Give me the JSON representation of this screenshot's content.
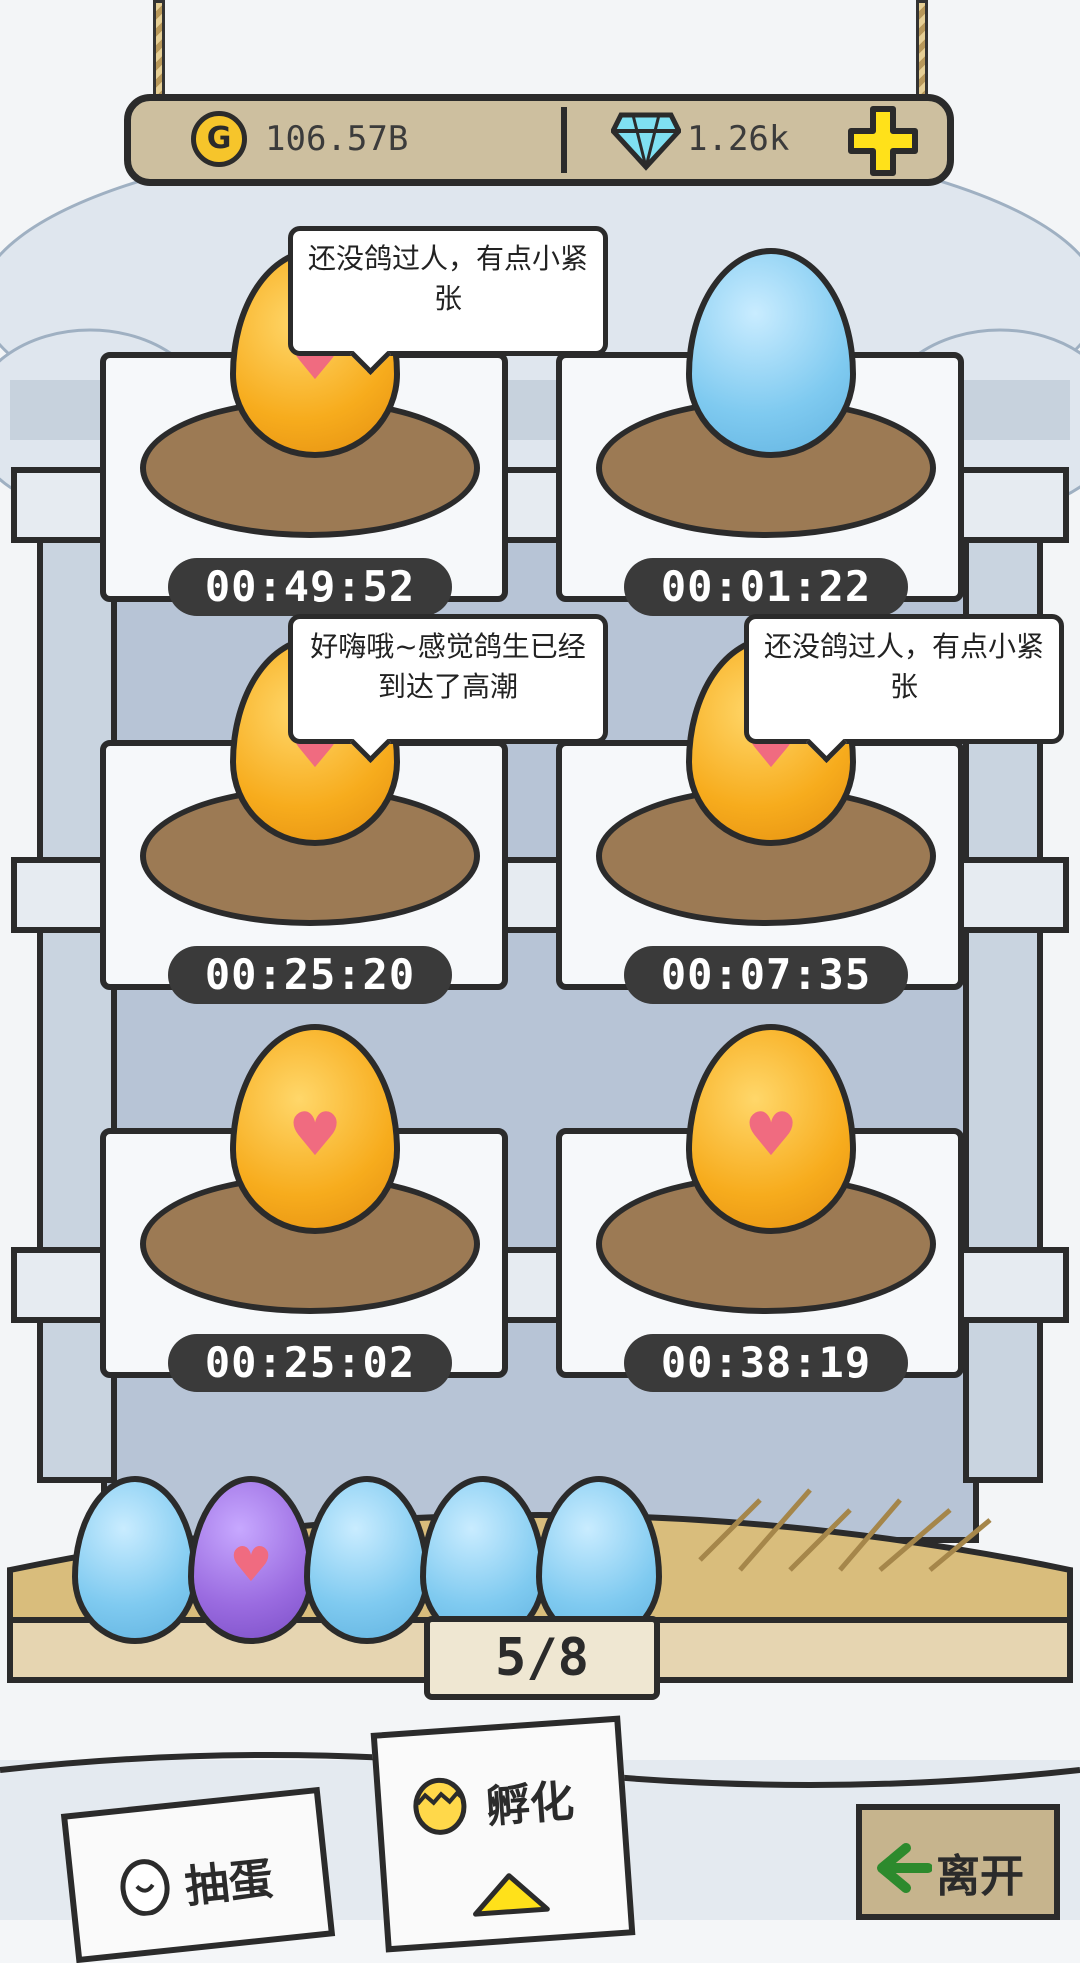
{
  "currency": {
    "gold_label": "106.57B",
    "gold_symbol": "G",
    "gem_label": "1.26k",
    "plus_symbol": "+"
  },
  "nests": [
    {
      "egg": "gold",
      "timer": "00:49:52",
      "bubble": "还没鸽过人，有点小紧张"
    },
    {
      "egg": "blue",
      "timer": "00:01:22",
      "bubble": ""
    },
    {
      "egg": "gold",
      "timer": "00:25:20",
      "bubble": "好嗨哦~感觉鸽生已经到达了高潮"
    },
    {
      "egg": "gold",
      "timer": "00:07:35",
      "bubble": "还没鸽过人，有点小紧张"
    },
    {
      "egg": "gold",
      "timer": "00:25:02",
      "bubble": ""
    },
    {
      "egg": "gold",
      "timer": "00:38:19",
      "bubble": ""
    }
  ],
  "basket": {
    "eggs": [
      "blue",
      "purple",
      "blue",
      "blue",
      "blue"
    ],
    "counter": "5/8"
  },
  "nav": {
    "draw_label": "抽蛋",
    "hatch_label": "孵化",
    "leave_label": "离开"
  },
  "colors": {
    "gold_egg": "#f7ac1d",
    "blue_egg": "#7fcaf0",
    "purple_egg": "#9a6be0",
    "heart": "#f06b80",
    "timer_bg": "#3a3a3a",
    "wood": "#cdbf9f"
  }
}
